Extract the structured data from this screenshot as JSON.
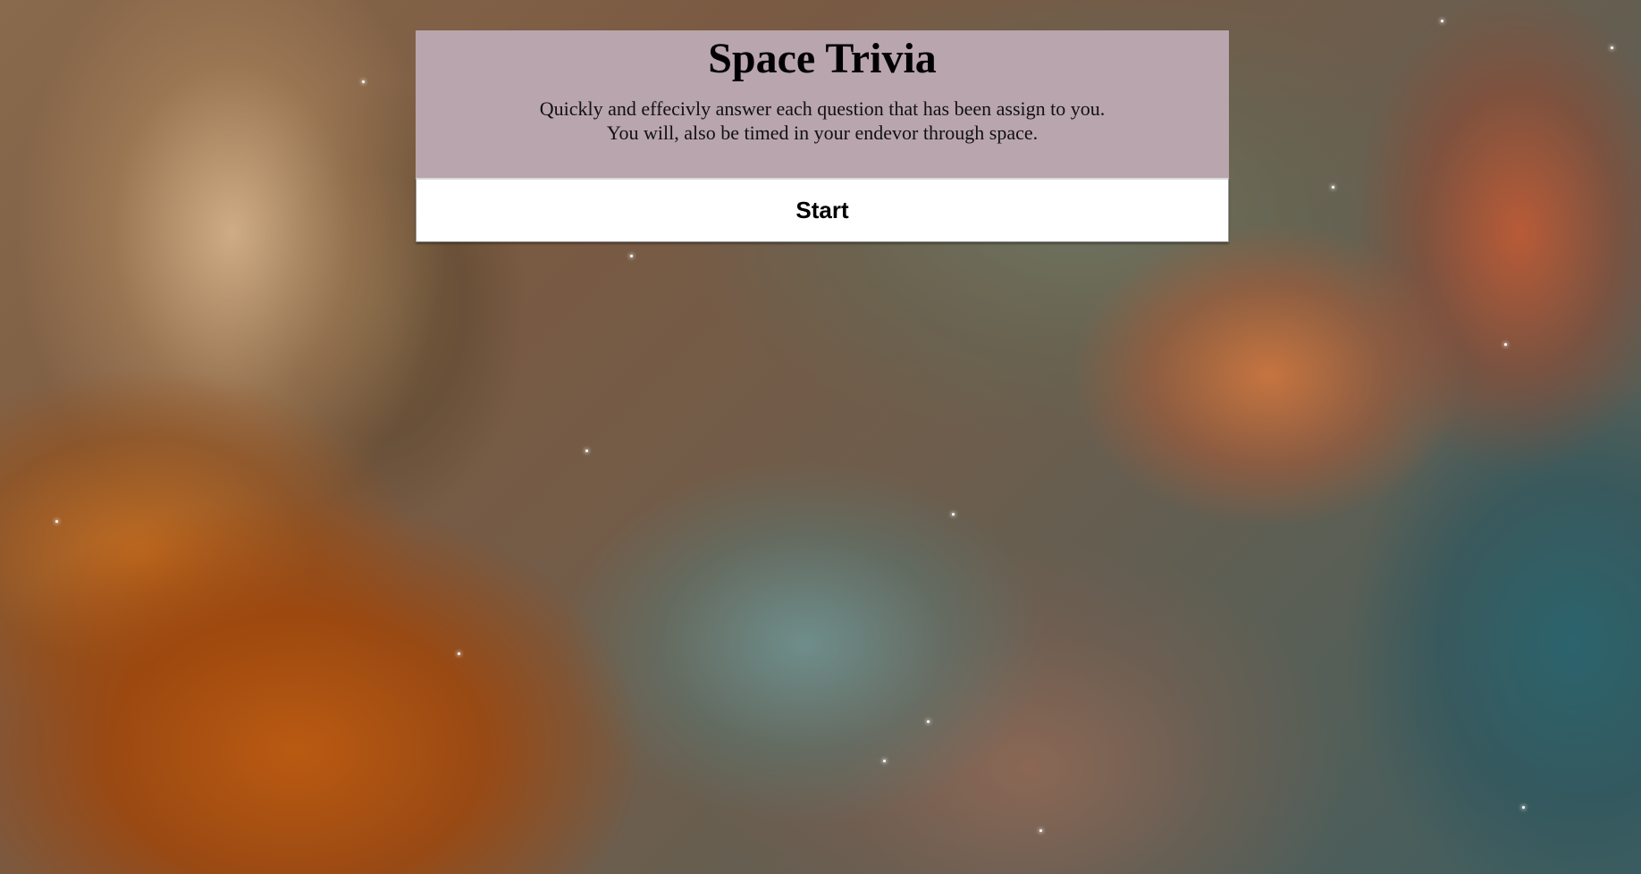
{
  "page": {
    "title": "Space Trivia",
    "description_lines": [
      "Quickly and effecivly answer each question that has been assign to you.",
      "You will, also be timed in your endevor through space."
    ]
  },
  "actions": {
    "start_label": "Start"
  },
  "background": {
    "description_icon": "nebula-image"
  },
  "colors": {
    "header_bg": "#b9a5ad",
    "button_bg": "#ffffff"
  }
}
